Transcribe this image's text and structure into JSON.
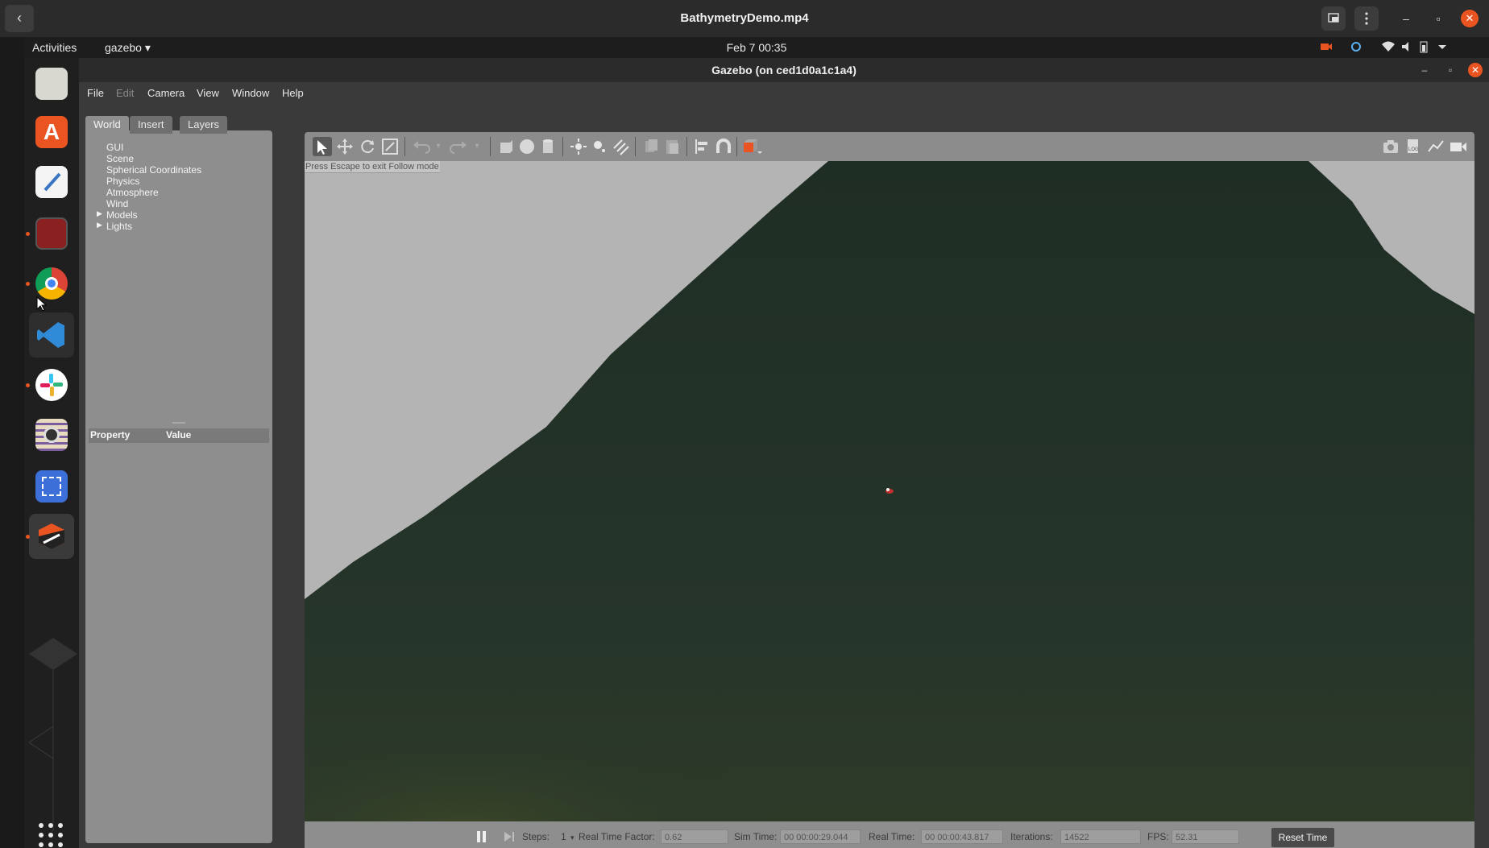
{
  "player": {
    "title": "BathymetryDemo.mp4",
    "back_icon": "‹",
    "minimize": "–",
    "maximize": "▫",
    "close": "✕"
  },
  "desktop": {
    "activities": "Activities",
    "app_menu": "gazebo ▾",
    "clock": "Feb 7  00:35",
    "dock_apps": [
      "files",
      "ubuntu-software",
      "text-editor",
      "terminal-app",
      "chrome",
      "vscode",
      "slack",
      "camera",
      "screenshot",
      "gazebo"
    ]
  },
  "gazebo": {
    "title": "Gazebo (on ced1d0a1c1a4)",
    "menu": [
      "File",
      "Edit",
      "Camera",
      "View",
      "Window",
      "Help"
    ],
    "tabs": [
      "World",
      "Insert",
      "Layers"
    ],
    "tree": [
      "GUI",
      "Scene",
      "Spherical Coordinates",
      "Physics",
      "Atmosphere",
      "Wind",
      "Models",
      "Lights"
    ],
    "property_header": "Property",
    "value_header": "Value",
    "follow_hint": "Press Escape to exit Follow mode",
    "status": {
      "steps_label": "Steps:",
      "steps_value": "1",
      "rtf_label": "Real Time Factor:",
      "rtf_value": "0.62",
      "sim_time_label": "Sim Time:",
      "sim_time_value": "00 00:00:29.044",
      "real_time_label": "Real Time:",
      "real_time_value": "00 00:00:43.817",
      "iterations_label": "Iterations:",
      "iterations_value": "14522",
      "fps_label": "FPS:",
      "fps_value": "52.31",
      "reset_label": "Reset Time"
    }
  },
  "colors": {
    "accent": "#e95420",
    "terrain": "#243226",
    "sky": "#b4b4b4"
  }
}
